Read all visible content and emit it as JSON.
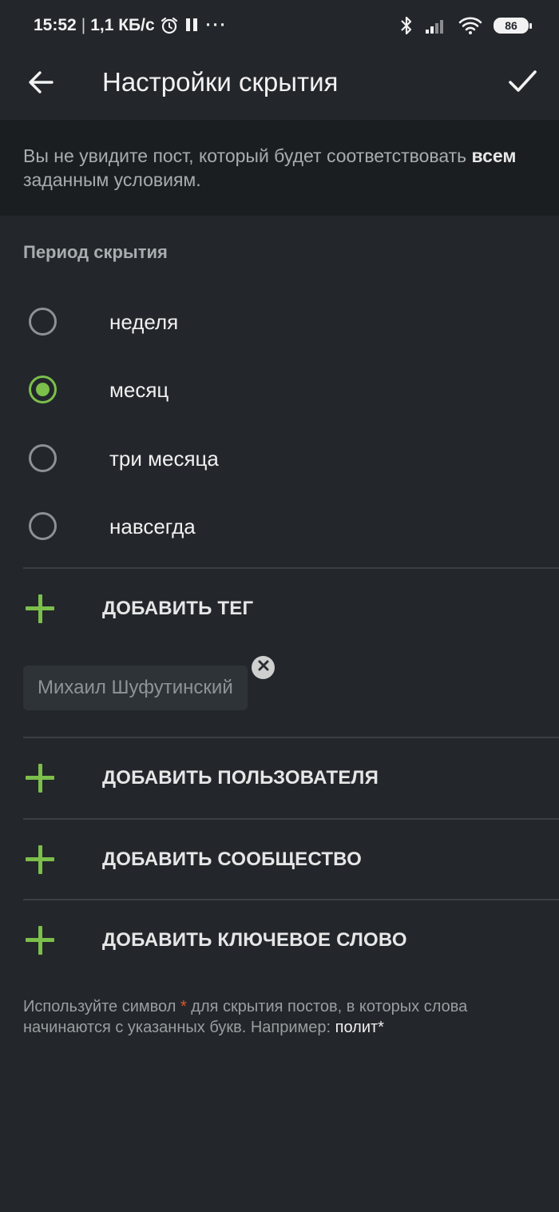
{
  "status_bar": {
    "time": "15:52",
    "separator": "|",
    "speed": "1,1 КБ/с",
    "more": "···",
    "battery": "86"
  },
  "toolbar": {
    "title": "Настройки скрытия"
  },
  "info": {
    "text_before": "Вы не увидите пост, который будет соответствовать ",
    "bold_word": "всем",
    "text_after": " заданным условиям."
  },
  "period": {
    "heading": "Период скрытия",
    "options": [
      {
        "label": "неделя",
        "checked": false
      },
      {
        "label": "месяц",
        "checked": true
      },
      {
        "label": "три месяца",
        "checked": false
      },
      {
        "label": "навсегда",
        "checked": false
      }
    ]
  },
  "add_tag": {
    "label": "ДОБАВИТЬ ТЕГ"
  },
  "tags": [
    {
      "label": "Михаил Шуфутинский"
    }
  ],
  "add_user": {
    "label": "ДОБАВИТЬ ПОЛЬЗОВАТЕЛЯ"
  },
  "add_community": {
    "label": "ДОБАВИТЬ СООБЩЕСТВО"
  },
  "add_keyword": {
    "label": "ДОБАВИТЬ КЛЮЧЕВОЕ СЛОВО"
  },
  "hint": {
    "before": "Используйте символ ",
    "star": "*",
    "after": " для скрытия постов, в которых слова начинаются с указанных букв. Например: ",
    "example": "полит*"
  },
  "colors": {
    "background": "#23272b",
    "banner": "#1b1e21",
    "accent": "#7cbf4b",
    "star": "#e0552f"
  }
}
